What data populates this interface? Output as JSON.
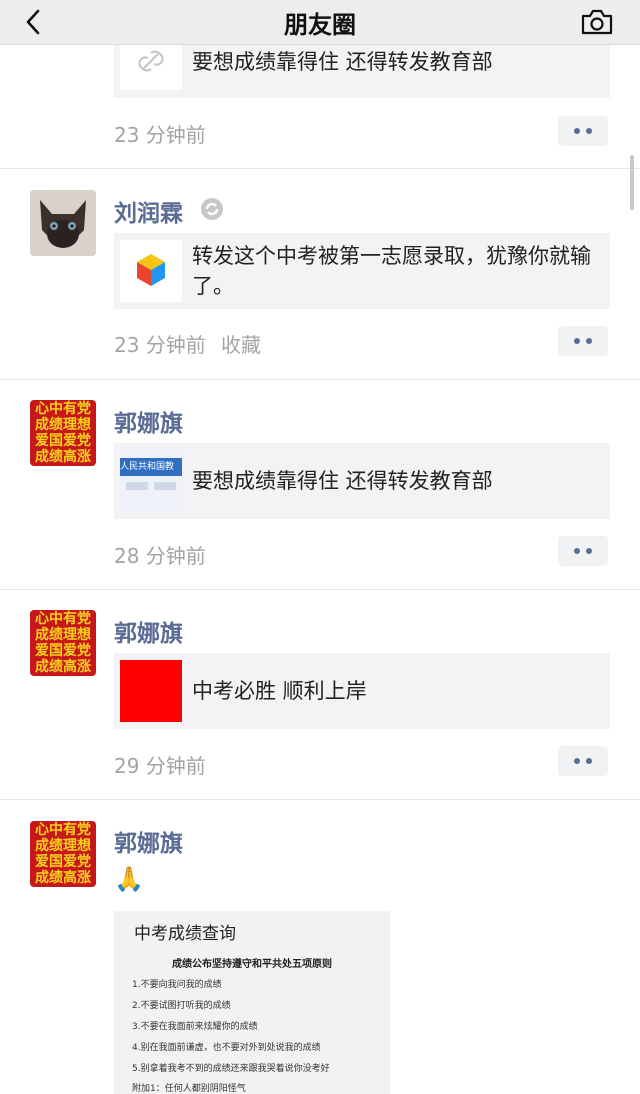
{
  "header": {
    "title": "朋友圈",
    "back_icon": "chevron-left-icon",
    "camera_icon": "camera-icon"
  },
  "posts": [
    {
      "share_text": "要想成绩靠得住 还得转发教育部",
      "time": "23 分钟前"
    },
    {
      "name": "刘润霖",
      "share_text": "转发这个中考被第一志愿录取，犹豫你就输了。",
      "time": "23 分钟前",
      "favorite_label": "收藏"
    },
    {
      "name": "郭娜旗",
      "avatar_lines": [
        "心中有党",
        "成绩理想",
        "爱国爱党",
        "成绩高涨"
      ],
      "thumb_text": "人民共和国教",
      "share_text": "要想成绩靠得住 还得转发教育部",
      "time": "28 分钟前"
    },
    {
      "name": "郭娜旗",
      "avatar_lines": [
        "心中有党",
        "成绩理想",
        "爱国爱党",
        "成绩高涨"
      ],
      "share_text": "中考必胜 顺利上岸",
      "time": "29 分钟前"
    },
    {
      "name": "郭娜旗",
      "avatar_lines": [
        "心中有党",
        "成绩理想",
        "爱国爱党",
        "成绩高涨"
      ],
      "emoji": "🙏",
      "image": {
        "title": "中考成绩查询",
        "subtitle": "成绩公布坚持遵守和平共处五项原则",
        "lines": [
          "1.不要向我问我的成绩",
          "2.不要试图打听我的成绩",
          "3.不要在我面前来炫耀你的成绩",
          "4.别在我面前谦虚，也不要对外到处说我的成绩",
          "5.别拿着我考不到的成绩还来跟我哭着说你没考好",
          "附加1：任何人都别阴阳怪气"
        ]
      }
    }
  ]
}
